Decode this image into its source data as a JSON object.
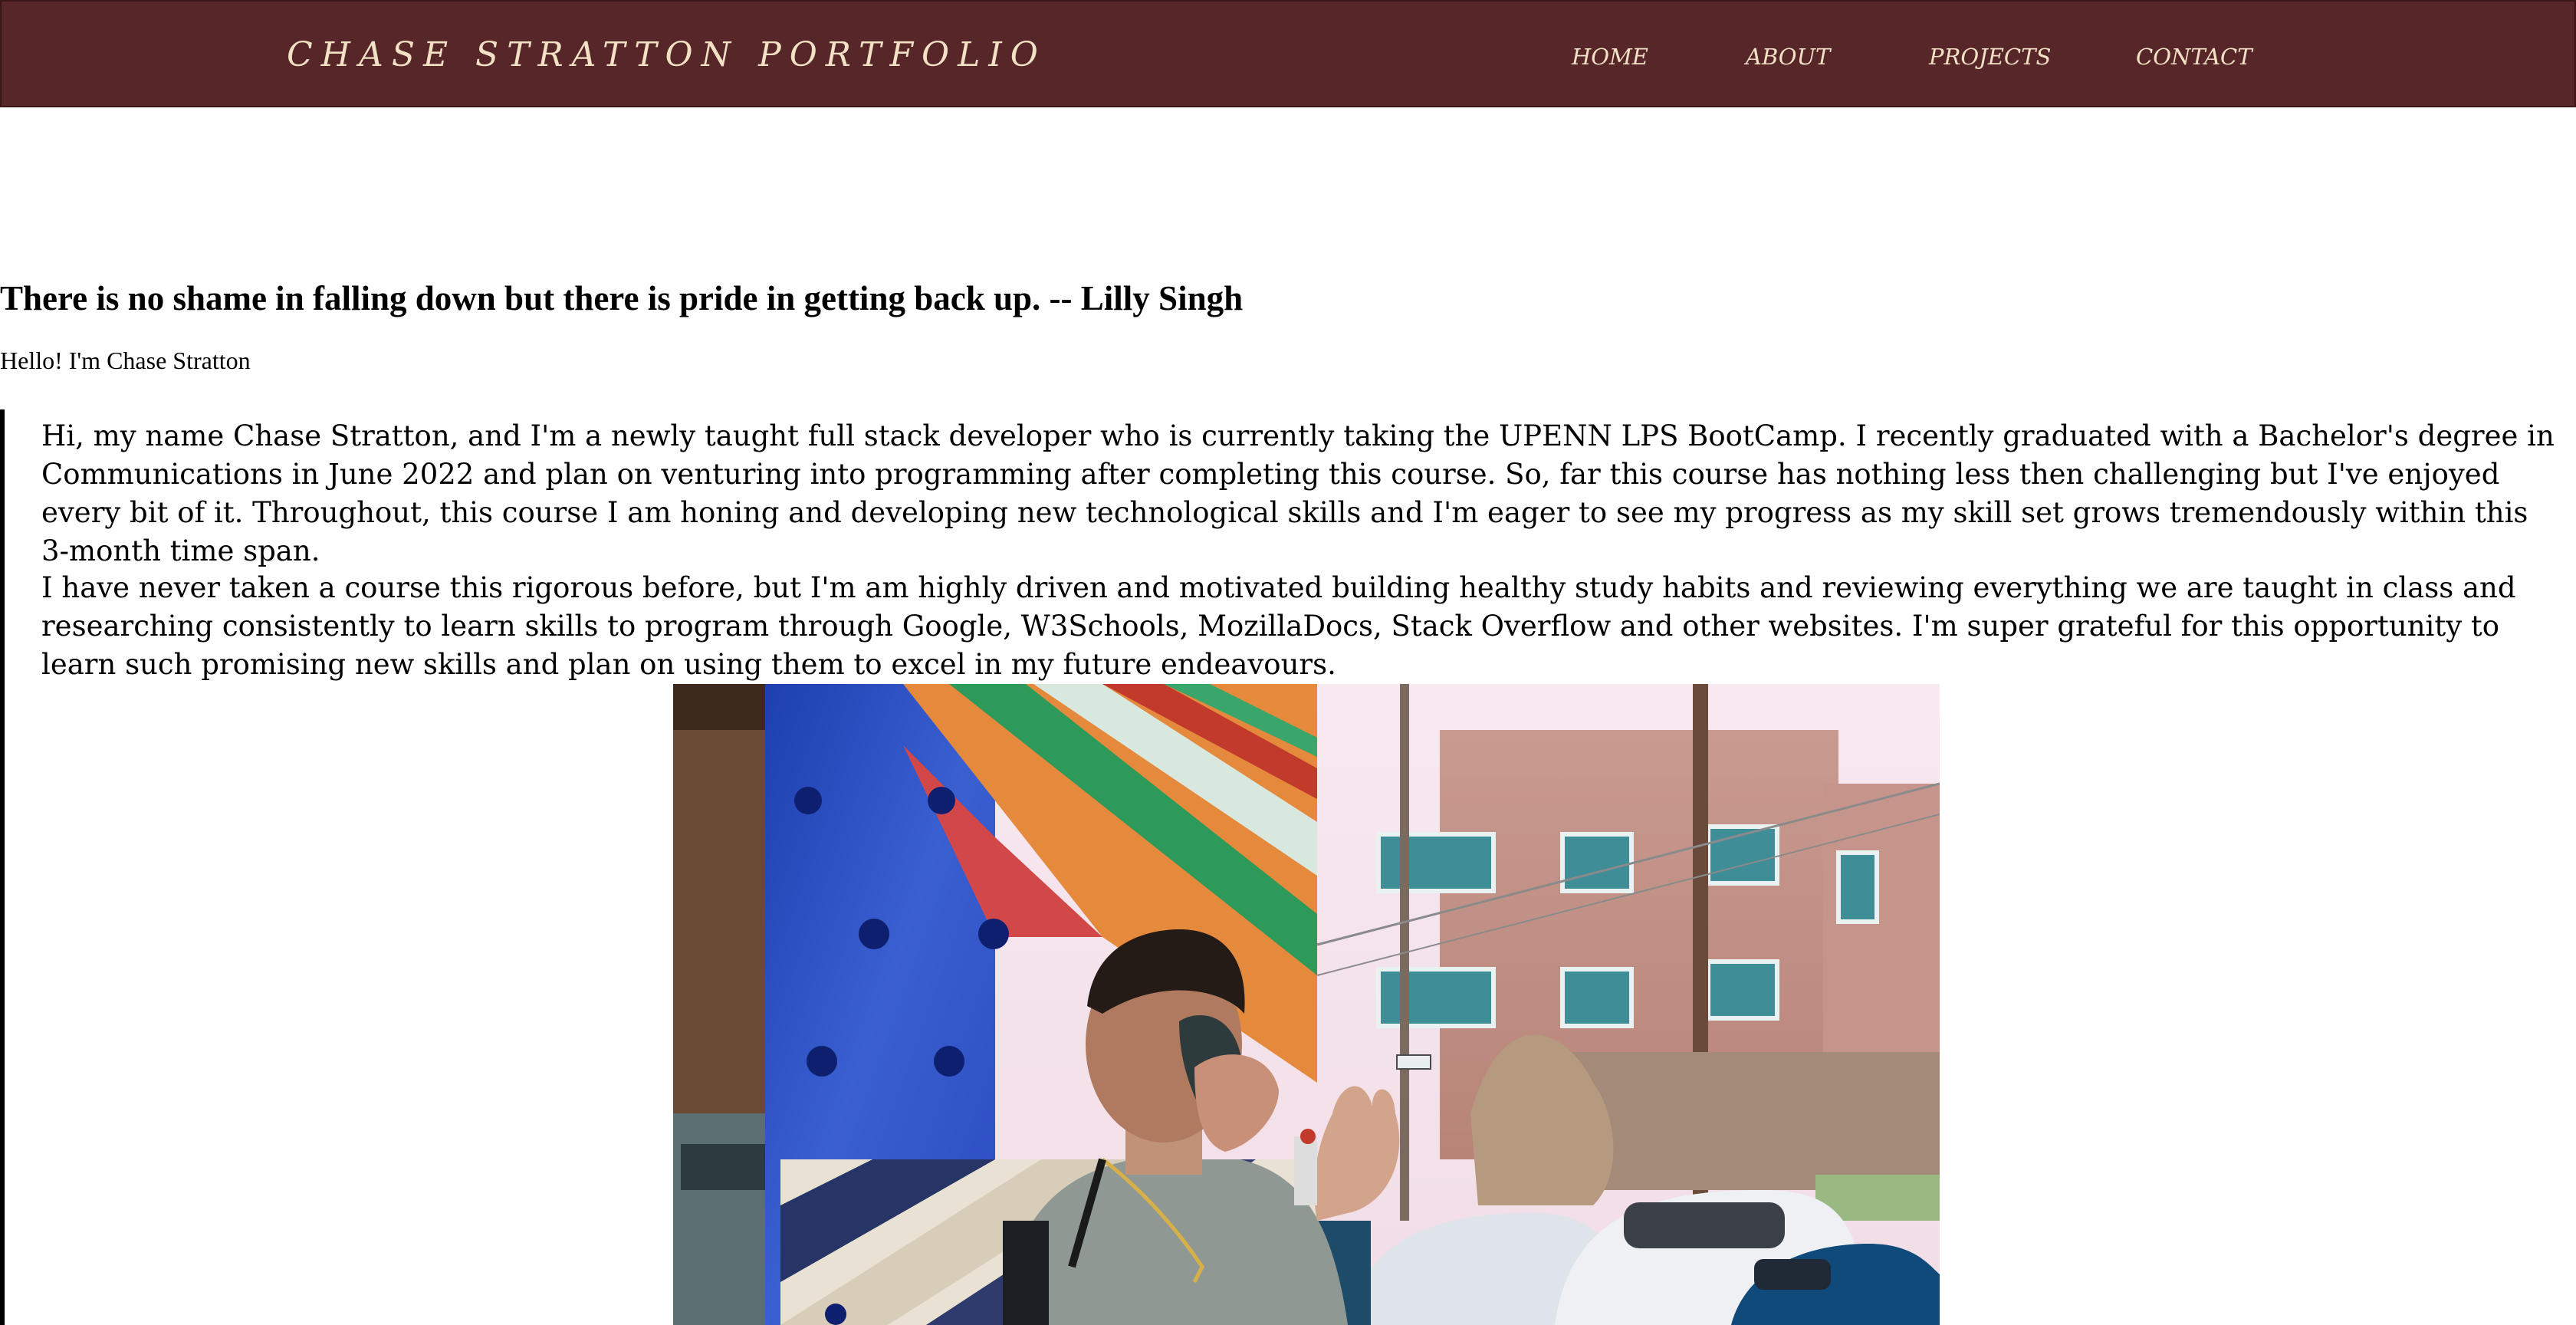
{
  "header": {
    "brand": "CHASE STRATTON PORTFOLIO",
    "nav": [
      {
        "label": "HOME"
      },
      {
        "label": "ABOUT"
      },
      {
        "label": "PROJECTS"
      },
      {
        "label": "CONTACT"
      }
    ]
  },
  "hero": {
    "quote": "There is no shame in falling down but there is pride in getting back up. -- Lilly Singh",
    "greeting": "Hello! I'm Chase Stratton"
  },
  "about": {
    "paragraph_1": "Hi, my name Chase Stratton, and I'm a newly taught full stack developer who is currently taking the UPENN LPS BootCamp. I recently graduated with a Bachelor's degree in Communications in June 2022 and plan on venturing into programming after completing this course. So, far this course has nothing less then challenging but I've enjoyed every bit of it. Throughout, this course I am honing and developing new technological skills and I'm eager to see my progress as my skill set grows tremendously within this 3-month time span.",
    "paragraph_2": "I have never taken a course this rigorous before, but I'm am highly driven and motivated building healthy study habits and reviewing everything we are taught in class and researching consistently to learn skills to program through Google, W3Schools, MozillaDocs, Stack Overflow and other websites. I'm super grateful for this opportunity to learn such promising new skills and plan on using them to excel in my future endeavours."
  },
  "colors": {
    "navbar_bg": "#562629",
    "nav_text": "#f3e1c5",
    "body_bg": "#ffffff",
    "text": "#000000"
  }
}
